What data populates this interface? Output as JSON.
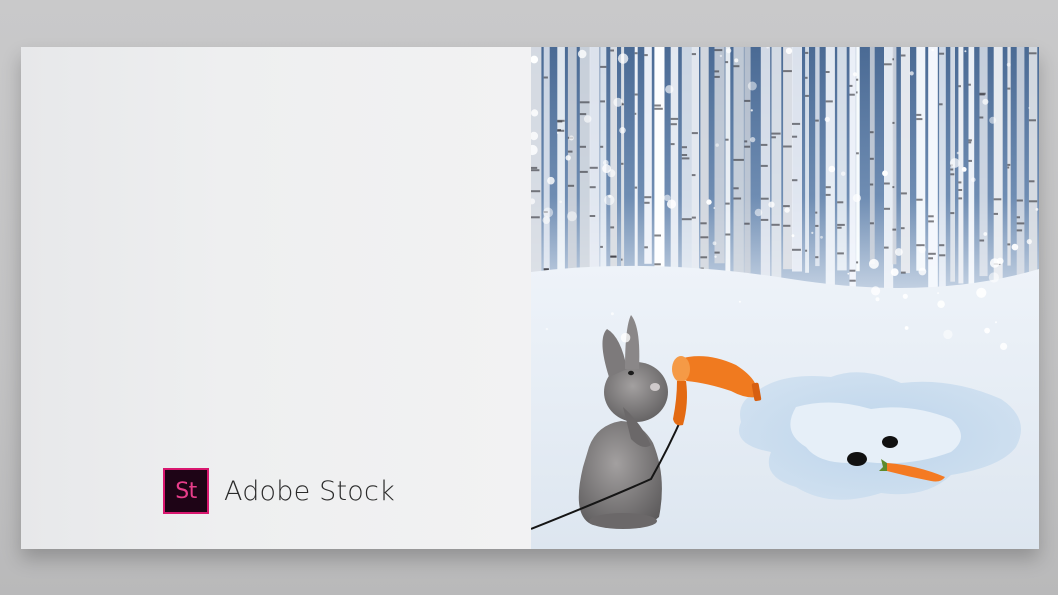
{
  "logo": {
    "badge_text": "St",
    "name": "Adobe Stock"
  },
  "colors": {
    "badge_bg": "#1e0416",
    "badge_accent": "#d8176f",
    "hair_dryer": "#f07a1f",
    "carrot": "#f47a22"
  }
}
